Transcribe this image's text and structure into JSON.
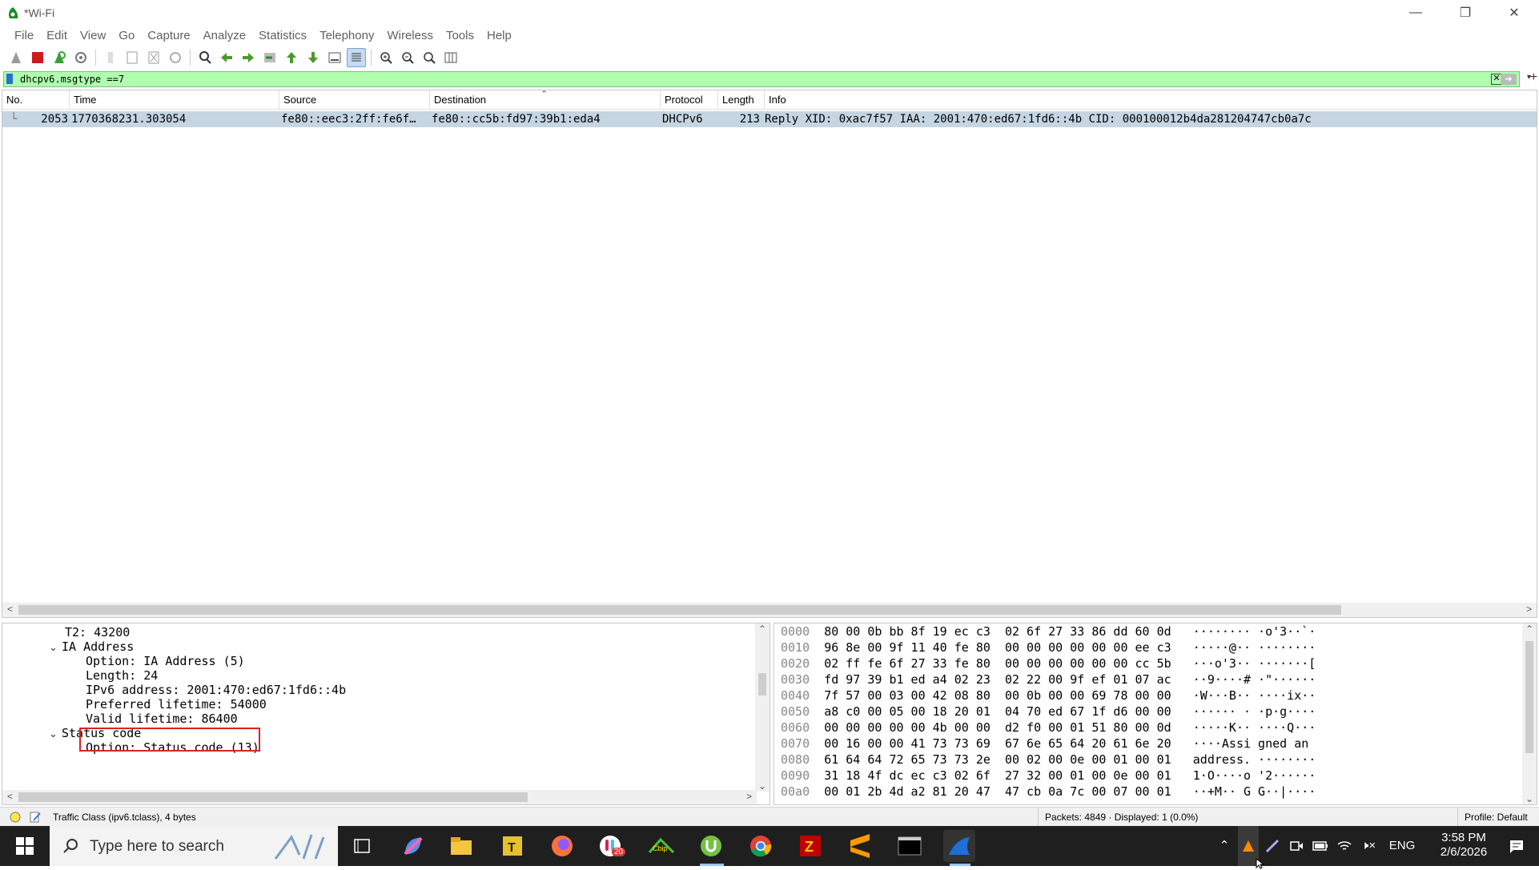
{
  "window": {
    "title": "*Wi-Fi"
  },
  "menu": [
    "File",
    "Edit",
    "View",
    "Go",
    "Capture",
    "Analyze",
    "Statistics",
    "Telephony",
    "Wireless",
    "Tools",
    "Help"
  ],
  "filter": {
    "value": "dhcpv6.msgtype ==7"
  },
  "packet_list": {
    "columns": [
      "No.",
      "Time",
      "Source",
      "Destination",
      "Protocol",
      "Length",
      "Info"
    ],
    "rows": [
      {
        "no": "2053",
        "time": "1770368231.303054",
        "source": "fe80::eec3:2ff:fe6f…",
        "destination": "fe80::cc5b:fd97:39b1:eda4",
        "protocol": "DHCPv6",
        "length": "213",
        "info": "Reply XID: 0xac7f57 IAA: 2001:470:ed67:1fd6::4b CID: 000100012b4da281204747cb0a7c"
      }
    ]
  },
  "details": {
    "lines": [
      "T2: 43200",
      "IA Address",
      "Option: IA Address (5)",
      "Length: 24",
      "IPv6 address: 2001:470:ed67:1fd6::4b",
      "Preferred lifetime: 54000",
      "Valid lifetime: 86400",
      "Status code",
      "Option: Status code (13)"
    ]
  },
  "bytes": {
    "rows": [
      {
        "off": "0000",
        "hex": "80 00 0b bb 8f 19 ec c3  02 6f 27 33 86 dd 60 0d",
        "ascii": "········ ·o'3··`·"
      },
      {
        "off": "0010",
        "hex": "96 8e 00 9f 11 40 fe 80  00 00 00 00 00 00 ee c3",
        "ascii": "·····@·· ········"
      },
      {
        "off": "0020",
        "hex": "02 ff fe 6f 27 33 fe 80  00 00 00 00 00 00 cc 5b",
        "ascii": "···o'3·· ·······["
      },
      {
        "off": "0030",
        "hex": "fd 97 39 b1 ed a4 02 23  02 22 00 9f ef 01 07 ac",
        "ascii": "··9····# ·\"······"
      },
      {
        "off": "0040",
        "hex": "7f 57 00 03 00 42 08 80  00 0b 00 00 69 78 00 00",
        "ascii": "·W···B·· ····ix··"
      },
      {
        "off": "0050",
        "hex": "a8 c0 00 05 00 18 20 01  04 70 ed 67 1f d6 00 00",
        "ascii": "······ · ·p·g····"
      },
      {
        "off": "0060",
        "hex": "00 00 00 00 00 4b 00 00  d2 f0 00 01 51 80 00 0d",
        "ascii": "·····K·· ····Q···"
      },
      {
        "off": "0070",
        "hex": "00 16 00 00 41 73 73 69  67 6e 65 64 20 61 6e 20",
        "ascii": "····Assi gned an "
      },
      {
        "off": "0080",
        "hex": "61 64 64 72 65 73 73 2e  00 02 00 0e 00 01 00 01",
        "ascii": "address. ········"
      },
      {
        "off": "0090",
        "hex": "31 18 4f dc ec c3 02 6f  27 32 00 01 00 0e 00 01",
        "ascii": "1·O····o '2······"
      },
      {
        "off": "00a0",
        "hex": "00 01 2b 4d a2 81 20 47  47 cb 0a 7c 00 07 00 01",
        "ascii": "··+M·· G G··|····"
      }
    ]
  },
  "status": {
    "field": "Traffic Class (ipv6.tclass), 4 bytes",
    "packets": "Packets: 4849 · Displayed: 1 (0.0%)",
    "profile": "Profile: Default"
  },
  "taskbar": {
    "search_placeholder": "Type here to search",
    "language": "ENG",
    "time": "3:58 PM",
    "date": "2/6/2026",
    "slack_badge": "20"
  },
  "colors": {
    "filter_valid": "#afffaf",
    "selected_row": "#c5d5e2",
    "highlight_box": "#d22222",
    "taskbar": "#1f1f1f"
  }
}
